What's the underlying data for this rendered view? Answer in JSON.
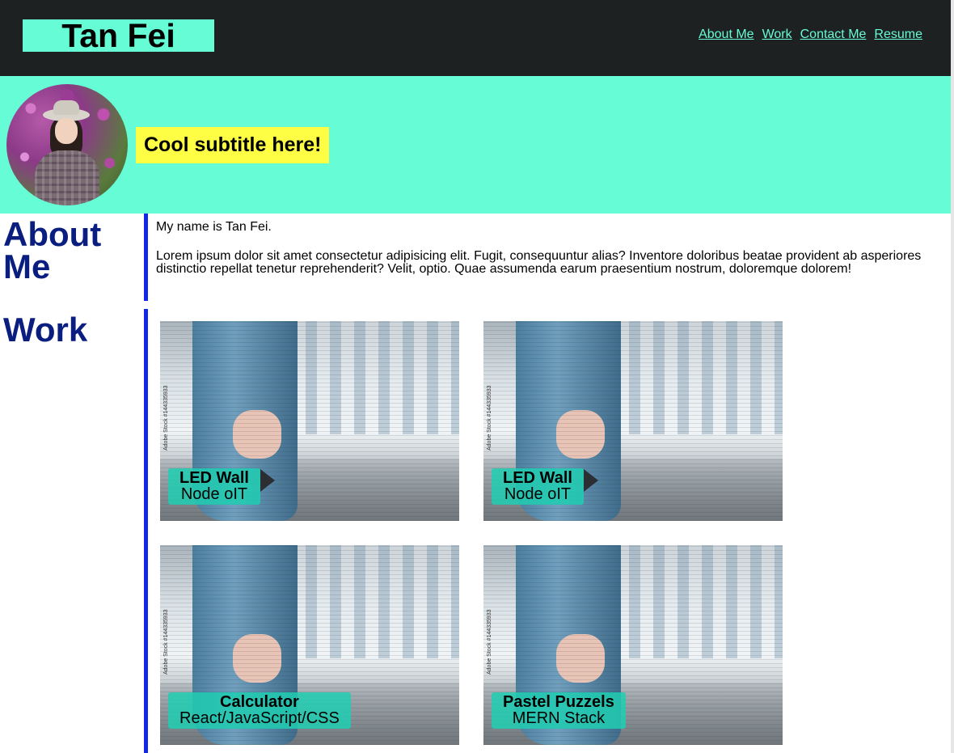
{
  "header": {
    "brand": "Tan Fei",
    "nav": [
      "About Me",
      "Work",
      "Contact Me",
      "Resume"
    ]
  },
  "hero": {
    "subtitle": "Cool subtitle here!"
  },
  "about": {
    "title": "About Me",
    "paragraphs": [
      "My name is Tan Fei.",
      "Lorem ipsum dolor sit amet consectetur adipisicing elit. Fugit, consequuntur alias? Inventore doloribus beatae provident ab asperiores distinctio repellat tenetur reprehenderit? Velit, optio. Quae assumenda earum praesentium nostrum, doloremque dolorem!"
    ]
  },
  "work": {
    "title": "Work",
    "projects": [
      {
        "title": "LED Wall",
        "tech": "Node oIT"
      },
      {
        "title": "LED Wall",
        "tech": "Node oIT"
      },
      {
        "title": "Calculator",
        "tech": "React/JavaScript/CSS"
      },
      {
        "title": "Pastel Puzzels",
        "tech": "MERN Stack"
      }
    ],
    "image_stamp": "Adobe Stock #144335933"
  },
  "colors": {
    "header_bg": "#1d2122",
    "accent": "#66fcd6",
    "subtitle_bg": "#fefe44",
    "heading": "#0a1e80",
    "section_bar": "#1226ee",
    "card_label": "#20ceb2"
  }
}
